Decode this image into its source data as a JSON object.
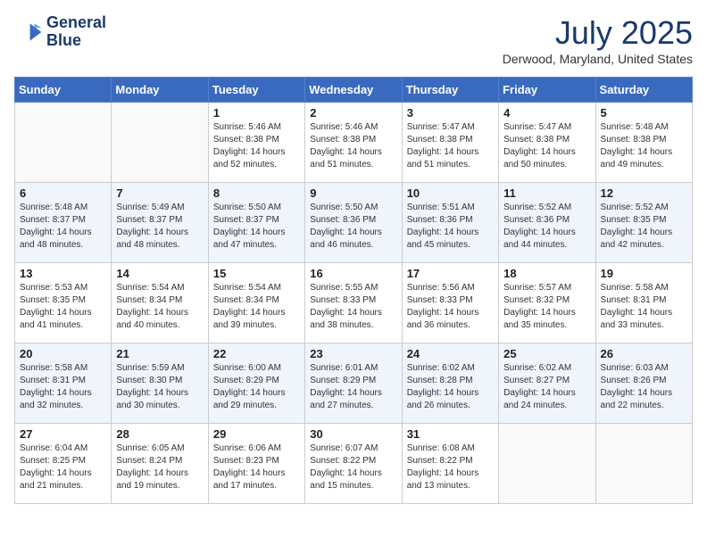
{
  "header": {
    "logo_line1": "General",
    "logo_line2": "Blue",
    "month_year": "July 2025",
    "location": "Derwood, Maryland, United States"
  },
  "weekdays": [
    "Sunday",
    "Monday",
    "Tuesday",
    "Wednesday",
    "Thursday",
    "Friday",
    "Saturday"
  ],
  "weeks": [
    [
      {
        "day": "",
        "info": ""
      },
      {
        "day": "",
        "info": ""
      },
      {
        "day": "1",
        "info": "Sunrise: 5:46 AM\nSunset: 8:38 PM\nDaylight: 14 hours and 52 minutes."
      },
      {
        "day": "2",
        "info": "Sunrise: 5:46 AM\nSunset: 8:38 PM\nDaylight: 14 hours and 51 minutes."
      },
      {
        "day": "3",
        "info": "Sunrise: 5:47 AM\nSunset: 8:38 PM\nDaylight: 14 hours and 51 minutes."
      },
      {
        "day": "4",
        "info": "Sunrise: 5:47 AM\nSunset: 8:38 PM\nDaylight: 14 hours and 50 minutes."
      },
      {
        "day": "5",
        "info": "Sunrise: 5:48 AM\nSunset: 8:38 PM\nDaylight: 14 hours and 49 minutes."
      }
    ],
    [
      {
        "day": "6",
        "info": "Sunrise: 5:48 AM\nSunset: 8:37 PM\nDaylight: 14 hours and 48 minutes."
      },
      {
        "day": "7",
        "info": "Sunrise: 5:49 AM\nSunset: 8:37 PM\nDaylight: 14 hours and 48 minutes."
      },
      {
        "day": "8",
        "info": "Sunrise: 5:50 AM\nSunset: 8:37 PM\nDaylight: 14 hours and 47 minutes."
      },
      {
        "day": "9",
        "info": "Sunrise: 5:50 AM\nSunset: 8:36 PM\nDaylight: 14 hours and 46 minutes."
      },
      {
        "day": "10",
        "info": "Sunrise: 5:51 AM\nSunset: 8:36 PM\nDaylight: 14 hours and 45 minutes."
      },
      {
        "day": "11",
        "info": "Sunrise: 5:52 AM\nSunset: 8:36 PM\nDaylight: 14 hours and 44 minutes."
      },
      {
        "day": "12",
        "info": "Sunrise: 5:52 AM\nSunset: 8:35 PM\nDaylight: 14 hours and 42 minutes."
      }
    ],
    [
      {
        "day": "13",
        "info": "Sunrise: 5:53 AM\nSunset: 8:35 PM\nDaylight: 14 hours and 41 minutes."
      },
      {
        "day": "14",
        "info": "Sunrise: 5:54 AM\nSunset: 8:34 PM\nDaylight: 14 hours and 40 minutes."
      },
      {
        "day": "15",
        "info": "Sunrise: 5:54 AM\nSunset: 8:34 PM\nDaylight: 14 hours and 39 minutes."
      },
      {
        "day": "16",
        "info": "Sunrise: 5:55 AM\nSunset: 8:33 PM\nDaylight: 14 hours and 38 minutes."
      },
      {
        "day": "17",
        "info": "Sunrise: 5:56 AM\nSunset: 8:33 PM\nDaylight: 14 hours and 36 minutes."
      },
      {
        "day": "18",
        "info": "Sunrise: 5:57 AM\nSunset: 8:32 PM\nDaylight: 14 hours and 35 minutes."
      },
      {
        "day": "19",
        "info": "Sunrise: 5:58 AM\nSunset: 8:31 PM\nDaylight: 14 hours and 33 minutes."
      }
    ],
    [
      {
        "day": "20",
        "info": "Sunrise: 5:58 AM\nSunset: 8:31 PM\nDaylight: 14 hours and 32 minutes."
      },
      {
        "day": "21",
        "info": "Sunrise: 5:59 AM\nSunset: 8:30 PM\nDaylight: 14 hours and 30 minutes."
      },
      {
        "day": "22",
        "info": "Sunrise: 6:00 AM\nSunset: 8:29 PM\nDaylight: 14 hours and 29 minutes."
      },
      {
        "day": "23",
        "info": "Sunrise: 6:01 AM\nSunset: 8:29 PM\nDaylight: 14 hours and 27 minutes."
      },
      {
        "day": "24",
        "info": "Sunrise: 6:02 AM\nSunset: 8:28 PM\nDaylight: 14 hours and 26 minutes."
      },
      {
        "day": "25",
        "info": "Sunrise: 6:02 AM\nSunset: 8:27 PM\nDaylight: 14 hours and 24 minutes."
      },
      {
        "day": "26",
        "info": "Sunrise: 6:03 AM\nSunset: 8:26 PM\nDaylight: 14 hours and 22 minutes."
      }
    ],
    [
      {
        "day": "27",
        "info": "Sunrise: 6:04 AM\nSunset: 8:25 PM\nDaylight: 14 hours and 21 minutes."
      },
      {
        "day": "28",
        "info": "Sunrise: 6:05 AM\nSunset: 8:24 PM\nDaylight: 14 hours and 19 minutes."
      },
      {
        "day": "29",
        "info": "Sunrise: 6:06 AM\nSunset: 8:23 PM\nDaylight: 14 hours and 17 minutes."
      },
      {
        "day": "30",
        "info": "Sunrise: 6:07 AM\nSunset: 8:22 PM\nDaylight: 14 hours and 15 minutes."
      },
      {
        "day": "31",
        "info": "Sunrise: 6:08 AM\nSunset: 8:22 PM\nDaylight: 14 hours and 13 minutes."
      },
      {
        "day": "",
        "info": ""
      },
      {
        "day": "",
        "info": ""
      }
    ]
  ]
}
